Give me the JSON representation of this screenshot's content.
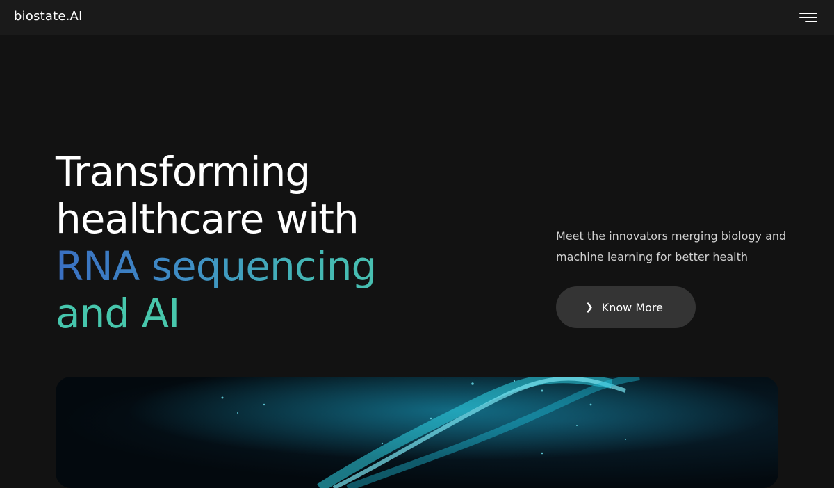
{
  "header": {
    "logo_text": "biostate.AI",
    "menu_icon": "hamburger-menu-icon"
  },
  "hero": {
    "title_line1": "Transforming",
    "title_line2": "healthcare with",
    "title_highlight1": "RNA sequencing",
    "title_highlight2": "and AI",
    "subtitle": "Meet the innovators merging biology and machine learning for better health",
    "cta_label": "Know More",
    "cta_icon": "chevron-right-icon"
  },
  "image": {
    "subject": "dna-helix-image"
  },
  "colors": {
    "background": "#121212",
    "header_bg": "#1a1a1a",
    "gradient_start": "#3a6fc2",
    "gradient_end": "#4cc9ad",
    "button_bg": "#343434",
    "dna_cyan": "#2fd4e6"
  }
}
